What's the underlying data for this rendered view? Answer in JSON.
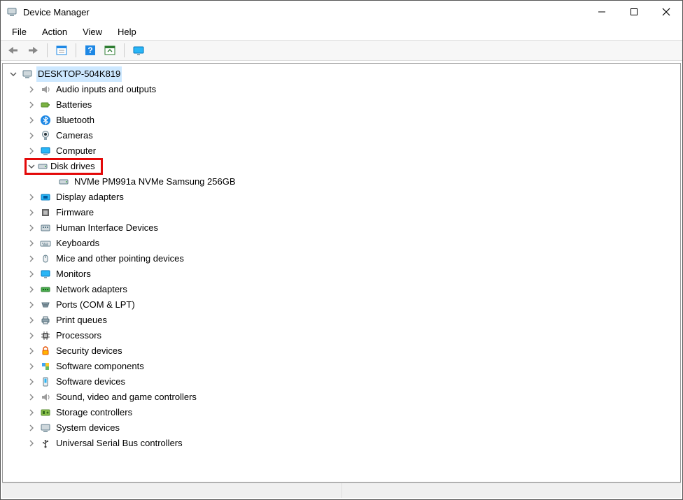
{
  "window": {
    "title": "Device Manager"
  },
  "menu": {
    "file": "File",
    "action": "Action",
    "view": "View",
    "help": "Help"
  },
  "tree": {
    "root": "DESKTOP-504K819",
    "audio": "Audio inputs and outputs",
    "batteries": "Batteries",
    "bluetooth": "Bluetooth",
    "cameras": "Cameras",
    "computer": "Computer",
    "diskdrives": "Disk drives",
    "diskdrives_child0": "NVMe PM991a NVMe Samsung 256GB",
    "display": "Display adapters",
    "firmware": "Firmware",
    "hid": "Human Interface Devices",
    "keyboards": "Keyboards",
    "mice": "Mice and other pointing devices",
    "monitors": "Monitors",
    "network": "Network adapters",
    "ports": "Ports (COM & LPT)",
    "printq": "Print queues",
    "processors": "Processors",
    "security": "Security devices",
    "swcomp": "Software components",
    "swdev": "Software devices",
    "sound": "Sound, video and game controllers",
    "storage": "Storage controllers",
    "system": "System devices",
    "usb": "Universal Serial Bus controllers"
  }
}
